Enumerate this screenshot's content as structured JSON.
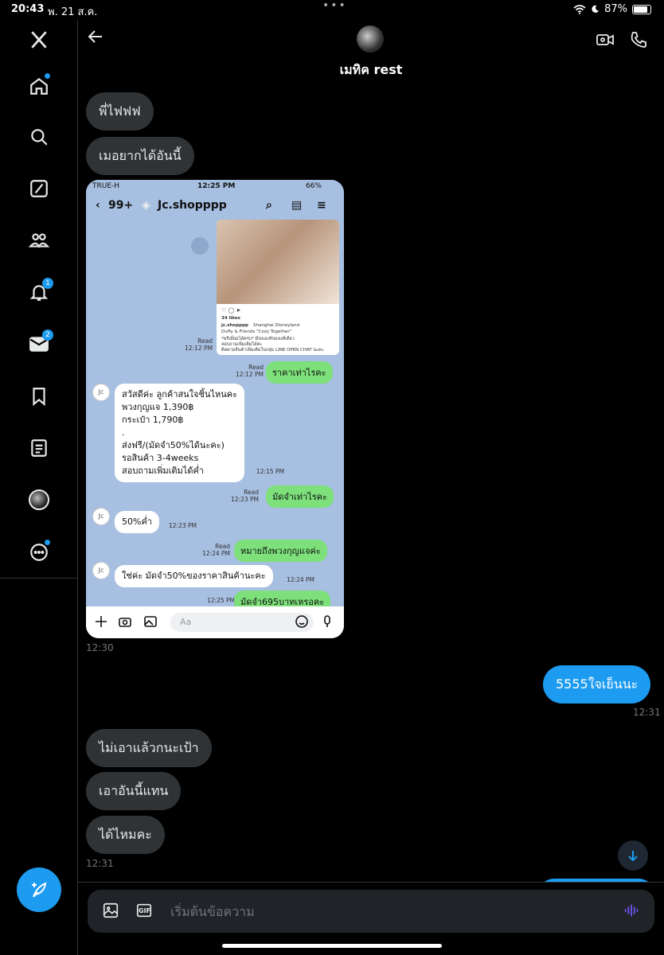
{
  "status": {
    "time": "20:43",
    "date": "พ. 21 ส.ค.",
    "battery": "87%",
    "battery_level": 0.87
  },
  "sidebar": {
    "items": [
      {
        "name": "home",
        "badge": "",
        "dot": true
      },
      {
        "name": "explore",
        "badge": ""
      },
      {
        "name": "grok",
        "badge": ""
      },
      {
        "name": "communities",
        "badge": ""
      },
      {
        "name": "notifications",
        "badge": "1"
      },
      {
        "name": "messages",
        "badge": "2"
      },
      {
        "name": "bookmarks",
        "badge": ""
      },
      {
        "name": "lists",
        "badge": ""
      },
      {
        "name": "profile",
        "badge": ""
      },
      {
        "name": "more",
        "badge": "",
        "dot": true
      }
    ]
  },
  "header": {
    "name": "เมทิค rest"
  },
  "messages": {
    "m1": "พี่ไฟฟฟ",
    "m2": "เมอยากได้อันนี้",
    "t1": "12:30",
    "m3": "5555ใจเย็นนะ",
    "t2": "12:31",
    "m4": "ไม่เอาแล้วกนะเป้า",
    "m5": "เอาอันนี้แทน",
    "m6": "ได้ไหมคะ",
    "t3": "12:31"
  },
  "attachment": {
    "carrier": "TRUE-H",
    "time": "12:25 PM",
    "battery": "66%",
    "unread": "99+",
    "shop": "Jc.shopppp",
    "card_likes": "34 likes",
    "card_account": "jc.shopppp",
    "card_location": "Shanghai Disneyland",
    "card_caption": "Duffy & Friends \"Cozy Together\"",
    "card_line3": "*พรีเมี่ยมได้ครบ* มีของแท้ของแท้เดียว",
    "card_line4": "สอบถามเพิ่มเติมได้ค่ะ",
    "card_line5": "ติดตามสินค้าเพิ่มเติมในกลุ่ม LINE OPEN CHAT นะคะ",
    "read_label": "Read",
    "ts_card": "12:12 PM",
    "l1": "ราคาเท่าไรคะ",
    "ts_l1": "12:12 PM",
    "l2_lines": [
      "สวัสดีค่ะ ลูกค้าสนใจชิ้นไหนคะ",
      "พวงกุญแจ 1,390฿",
      "กระเป๋า 1,790฿",
      ".",
      "ส่งฟรี/(มัดจำ50%ได้นะคะ)",
      "รอสินค้า 3-4weeks",
      "สอบถามเพิ่มเติมได้ค่ำ"
    ],
    "ts_l2": "12:15 PM",
    "l3": "มัดจำเท่าไรคะ",
    "ts_l3": "12:23 PM",
    "l4": "50%ค่ำ",
    "ts_l4": "12:23 PM",
    "l5": "หมายถึงพวงกุญแจค่ะ",
    "ts_l5": "12:24 PM",
    "l6": "ใช่ค่ะ มัดจำ50%ของราคาสินค้านะคะ",
    "ts_l6": "12:24 PM",
    "l7": "มัดจำ695บาทเหรอคะ",
    "ts_l7": "12:25 PM",
    "input_placeholder": "Aa",
    "avatar_text": "Jc"
  },
  "composer": {
    "placeholder": "เริ่มต้นข้อความ",
    "gif_label": "GIF"
  }
}
